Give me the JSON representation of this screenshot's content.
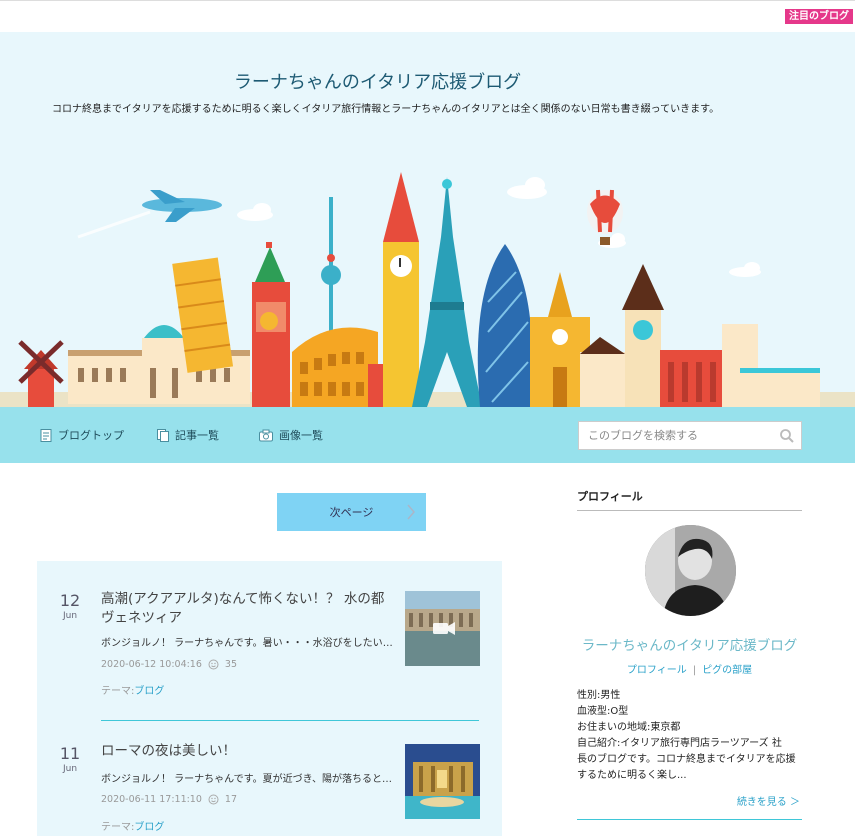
{
  "topbar": {
    "badge": "注目のブログ"
  },
  "header": {
    "title": "ラーナちゃんのイタリア応援ブログ",
    "description": "コロナ終息までイタリアを応援するために明るく楽しくイタリア旅行情報とラーナちゃんのイタリアとは全く関係のない日常も書き綴っていきます。"
  },
  "nav": {
    "items": [
      {
        "label": "ブログトップ",
        "icon": "document-icon"
      },
      {
        "label": "記事一覧",
        "icon": "copy-icon"
      },
      {
        "label": "画像一覧",
        "icon": "camera-icon"
      }
    ],
    "search_placeholder": "このブログを検索する"
  },
  "pager": {
    "next_label": "次ページ"
  },
  "entries": [
    {
      "day": "12",
      "month": "Jun",
      "title": "高潮(アクアアルタ)なんて怖くない！？ 水の都 ヴェネツィア",
      "excerpt": "ボンジョルノ！ ラーナちゃんです。暑い・・・水浴びをしたいくらいです・・・",
      "datetime": "2020-06-12 10:04:16",
      "likes": "35",
      "theme_label": "テーマ:",
      "theme": "ブログ"
    },
    {
      "day": "11",
      "month": "Jun",
      "title": "ローマの夜は美しい！",
      "excerpt": "ボンジョルノ！ ラーナちゃんです。夏が近づき、陽が落ちると涼しく・・・",
      "datetime": "2020-06-11 17:11:10",
      "likes": "17",
      "theme_label": "テーマ:",
      "theme": "ブログ"
    }
  ],
  "sidebar": {
    "heading": "プロフィール",
    "blog_name": "ラーナちゃんのイタリア応援ブログ",
    "link_profile": "プロフィール",
    "link_separator": "|",
    "link_room": "ピグの部屋",
    "info": [
      "性別:男性",
      "血液型:O型",
      "お住まいの地域:東京都",
      "自己紹介:イタリア旅行専門店ラーツアーズ 社",
      "長のブログです。コロナ終息までイタリアを応援",
      "するために明るく楽し..."
    ],
    "more": "続きを見る ＞"
  },
  "colors": {
    "hero_bg": "#e8f7fc",
    "nav_bg": "#97e1ec",
    "next_btn": "#7fd3f4",
    "accent_link": "#2aa1c9",
    "badge": "#e5388a"
  }
}
